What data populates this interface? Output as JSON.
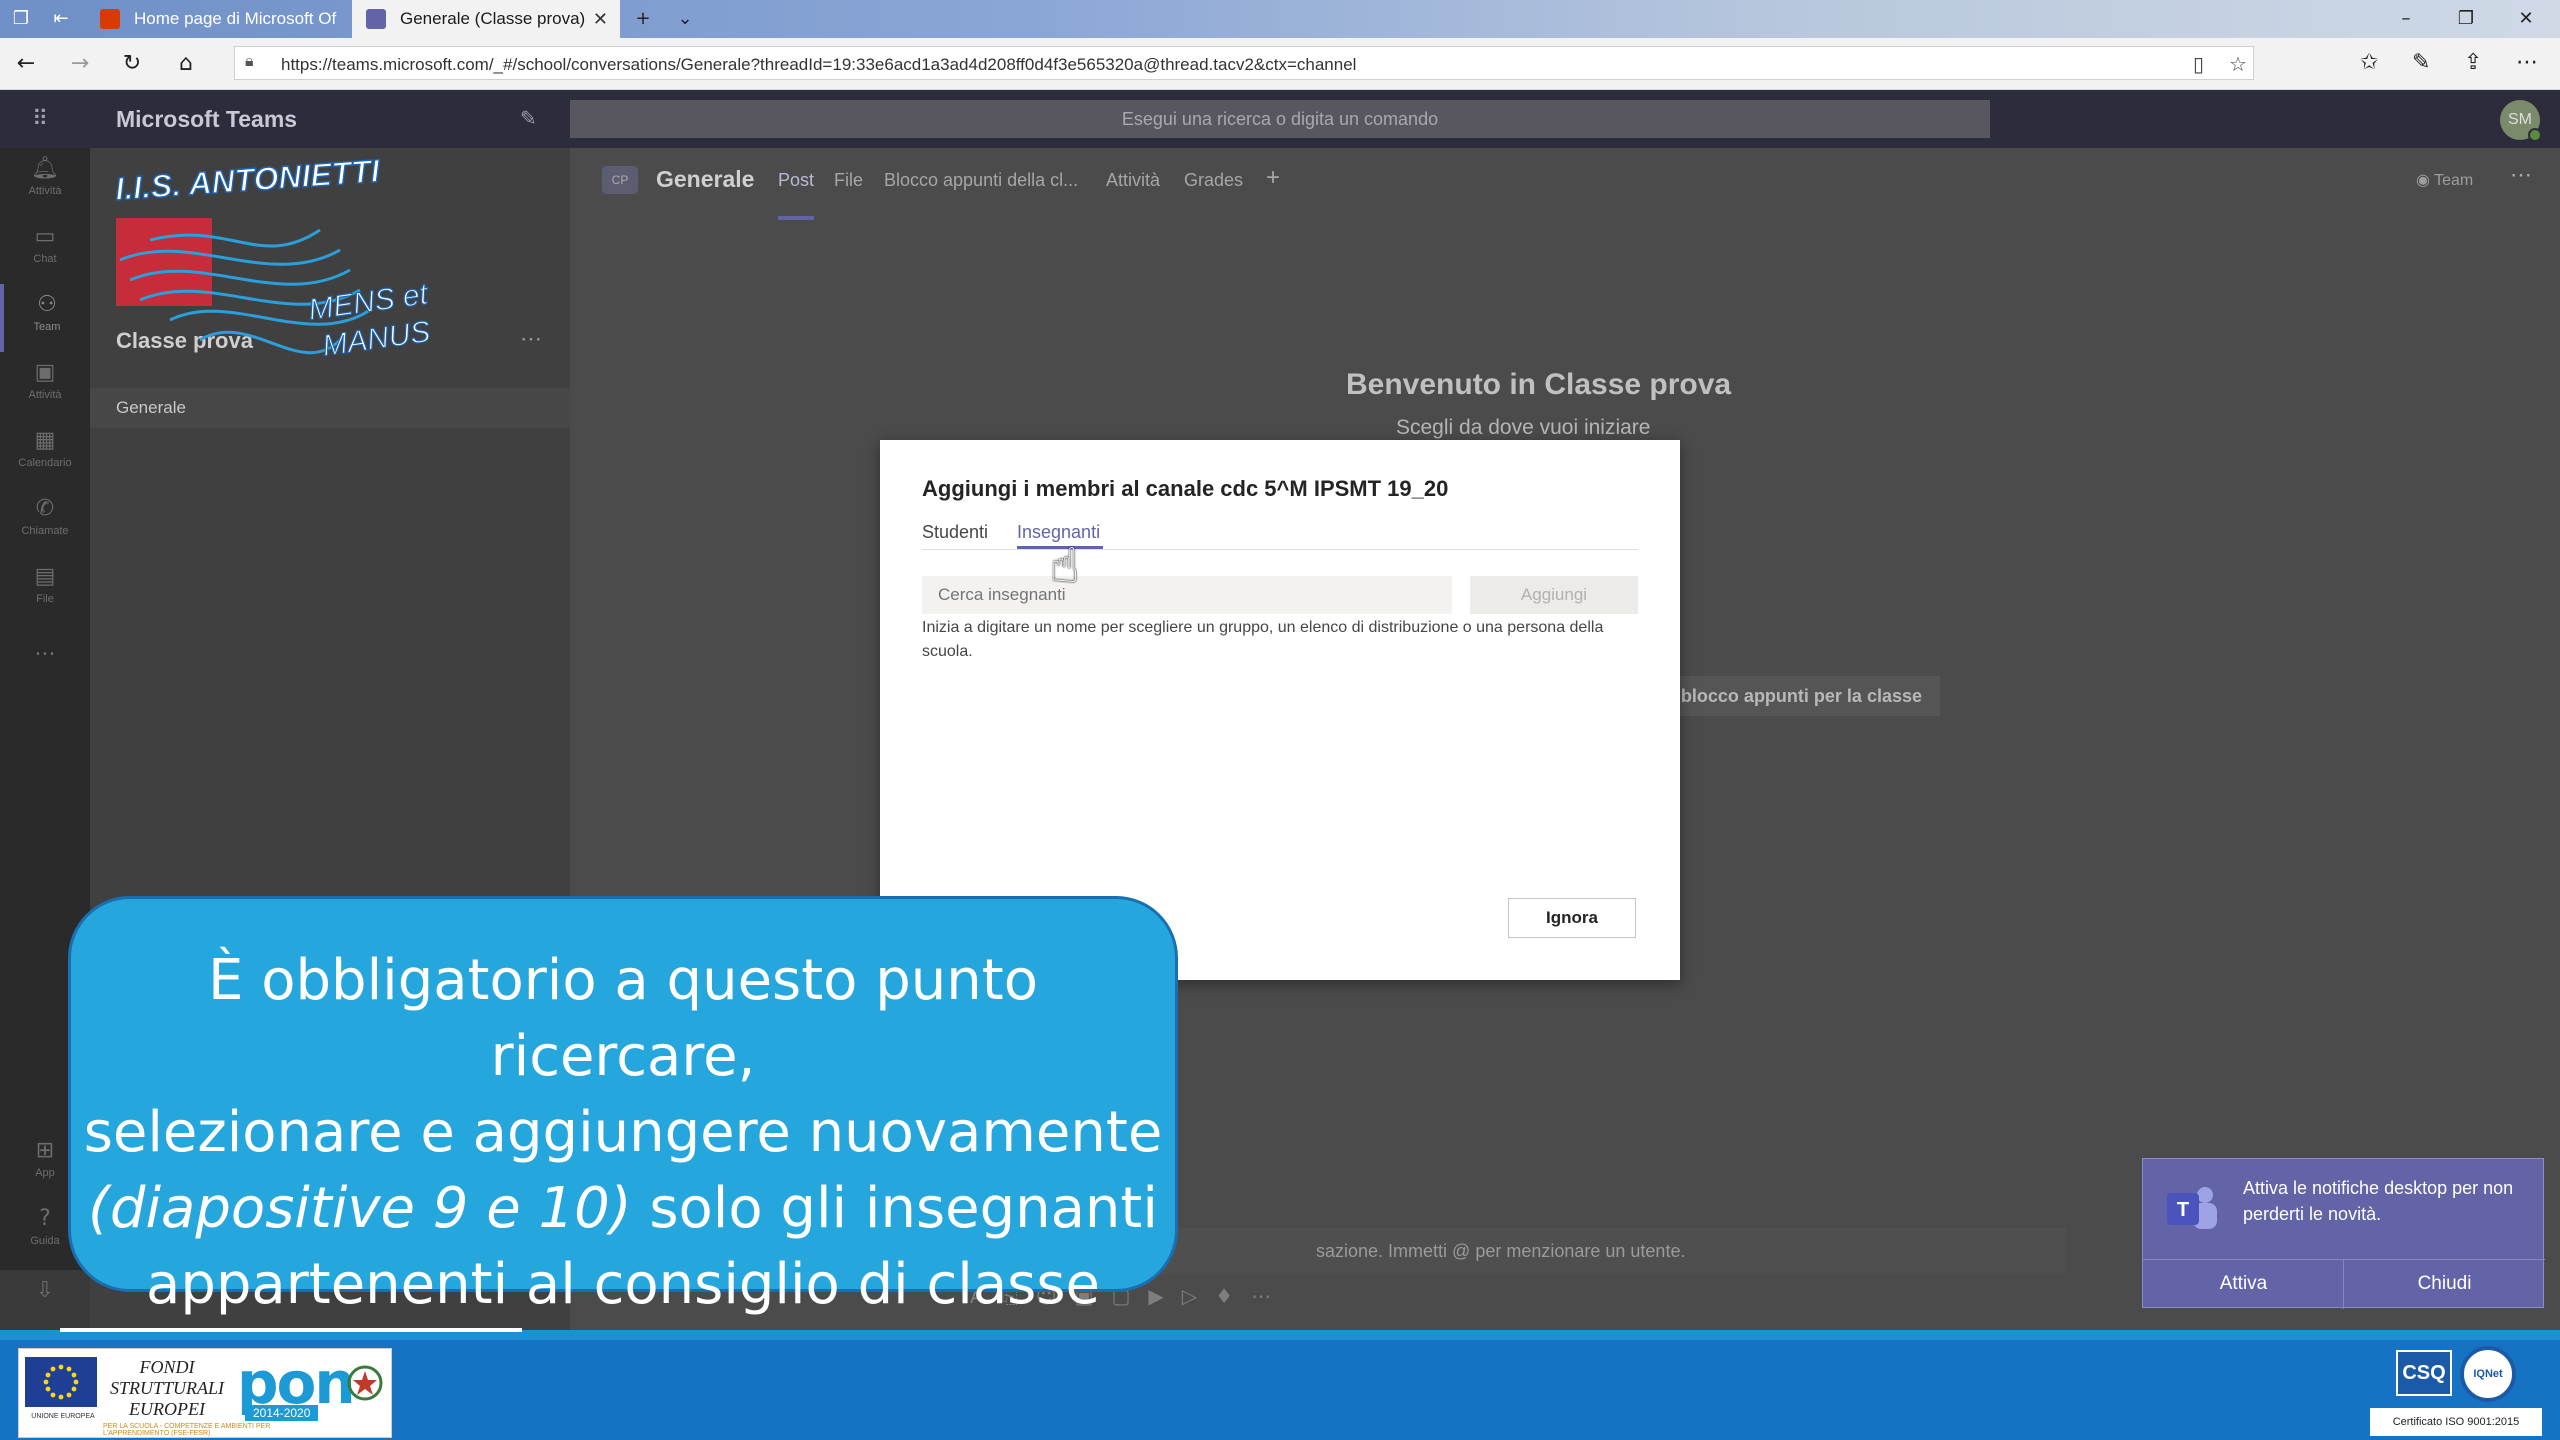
{
  "browser": {
    "tabs": [
      {
        "label": "Home page di Microsoft Of"
      },
      {
        "label": "Generale (Classe prova)"
      }
    ],
    "url": "https://teams.microsoft.com/_#/school/conversations/Generale?threadId=19:33e6acd1a3ad4d208ff0d4f3e565320a@thread.tacv2&ctx=channel"
  },
  "teams": {
    "app_title": "Microsoft Teams",
    "search_placeholder": "Esegui una ricerca o digita un comando",
    "avatar_initials": "SM",
    "rail": [
      {
        "label": "Attività",
        "icon": "bell-icon"
      },
      {
        "label": "Chat",
        "icon": "chat-icon"
      },
      {
        "label": "Team",
        "icon": "teams-icon"
      },
      {
        "label": "Attività",
        "icon": "assignments-icon"
      },
      {
        "label": "Calendario",
        "icon": "calendar-icon"
      },
      {
        "label": "Chiamate",
        "icon": "phone-icon"
      },
      {
        "label": "File",
        "icon": "file-icon"
      },
      {
        "label": "...",
        "icon": "more-icon"
      },
      {
        "label": "App",
        "icon": "apps-icon"
      },
      {
        "label": "Guida",
        "icon": "help-icon"
      }
    ],
    "team_name": "Classe prova",
    "channel_name": "Generale",
    "header": {
      "badge": "CP",
      "title": "Generale",
      "tabs": [
        "Post",
        "File",
        "Blocco appunti della cl...",
        "Attività",
        "Grades"
      ],
      "team_chip": "Team"
    },
    "welcome_title": "Benvenuto in Classe prova",
    "welcome_sub": "Scegli da dove vuoi iniziare",
    "notebook_button": "blocco appunti per la classe",
    "compose_text": "sazione. Immetti @ per menzionare un utente."
  },
  "dialog": {
    "title": "Aggiungi i membri al canale cdc 5^M IPSMT 19_20",
    "tabs": [
      "Studenti",
      "Insegnanti"
    ],
    "active_tab": "Insegnanti",
    "search_placeholder": "Cerca insegnanti",
    "add_button": "Aggiungi",
    "hint": "Inizia a digitare un nome per scegliere un gruppo, un elenco di distribuzione o una persona della scuola.",
    "ignore_button": "Ignora"
  },
  "overlay": {
    "logo_title": "I.I.S. ANTONIETTI",
    "logo_motto_1": "MENS et",
    "logo_motto_2": "MANUS",
    "caption_line1": "È obbligatorio a questo punto ricercare,",
    "caption_line2": "selezionare e aggiungere nuovamente",
    "caption_italic": "(diapositive 9 e 10)",
    "caption_line3_rest": " solo gli insegnanti",
    "caption_line4": "appartenenti al consiglio di classe"
  },
  "toast": {
    "text": "Attiva le notifiche desktop per non perderti le novità.",
    "activate": "Attiva",
    "close": "Chiudi"
  },
  "footer": {
    "fondi": "FONDI STRUTTURALI EUROPEI",
    "pon": "pon",
    "pon_years": "2014-2020",
    "eu_label": "UNIONE EUROPEA",
    "pon_sub": "PER LA SCUOLA - COMPETENZE E AMBIENTI PER L'APPRENDIMENTO (FSE-FESR)",
    "csq": "CSQ",
    "iqnet": "IQNet",
    "cert": "Certificato ISO 9001:2015"
  },
  "colors": {
    "teams_purple": "#6264a7",
    "caption_blue": "#25a6dc",
    "footer_blue": "#1673c4"
  }
}
